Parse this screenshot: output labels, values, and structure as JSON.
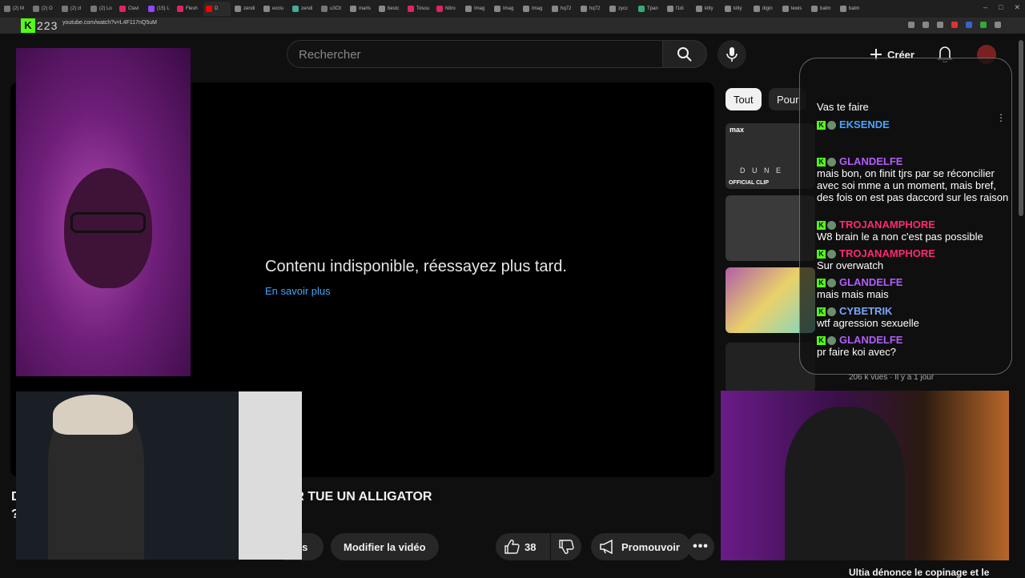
{
  "browser": {
    "tabs": [
      {
        "label": "(2) M",
        "color": "#777"
      },
      {
        "label": "(2) O",
        "color": "#777"
      },
      {
        "label": "(2) cl",
        "color": "#777"
      },
      {
        "label": "(2) Lo",
        "color": "#777"
      },
      {
        "label": "Clavi",
        "color": "#e0245e"
      },
      {
        "label": "(15) L",
        "color": "#9146ff"
      },
      {
        "label": "Flesh",
        "color": "#e0245e"
      },
      {
        "label": "D",
        "color": "#ff0000"
      },
      {
        "label": "zendi",
        "color": "#888"
      },
      {
        "label": "exclu",
        "color": "#888"
      },
      {
        "label": "zendi",
        "color": "#4a9"
      },
      {
        "label": "u3Clt",
        "color": "#777"
      },
      {
        "label": "marts",
        "color": "#888"
      },
      {
        "label": "bestc",
        "color": "#888"
      },
      {
        "label": "Tosou",
        "color": "#e0245e"
      },
      {
        "label": "Nitro",
        "color": "#e0245e"
      },
      {
        "label": "Imag",
        "color": "#888"
      },
      {
        "label": "Imag",
        "color": "#888"
      },
      {
        "label": "Imag",
        "color": "#888"
      },
      {
        "label": "hq72",
        "color": "#888"
      },
      {
        "label": "hq72",
        "color": "#888"
      },
      {
        "label": "zycc",
        "color": "#888"
      },
      {
        "label": "Tpan",
        "color": "#3a7"
      },
      {
        "label": "f1di",
        "color": "#888"
      },
      {
        "label": "kitty",
        "color": "#888"
      },
      {
        "label": "kitty",
        "color": "#888"
      },
      {
        "label": "digin",
        "color": "#888"
      },
      {
        "label": "lewis",
        "color": "#888"
      },
      {
        "label": "batm",
        "color": "#888"
      },
      {
        "label": "batm",
        "color": "#888"
      }
    ],
    "url": "youtube.com/watch?v=L4F117nQ5uM",
    "overlay_counter": "223"
  },
  "header": {
    "search_placeholder": "Rechercher",
    "create_label": "Créer"
  },
  "player": {
    "unavailable_message": "Contenu indisponible, réessayez plus tard.",
    "learn_more_link": "En savoir plus"
  },
  "video": {
    "title": "D TS DIMANCHE 21H????? 😡 💥 CLAVICULAR TUE UN ALLIGATOR",
    "title_line2": "?",
    "stats_label": "ues",
    "edit_label": "Modifier la vidéo",
    "likes": "38",
    "promote_label": "Promouvoir"
  },
  "sidebar": {
    "chips": [
      "Tout",
      "Pour"
    ],
    "thumb1_badge": "max",
    "thumb1_title": "D U N E",
    "thumb1_clip": "OFFICIAL CLIP",
    "item4_meta": "206 k vues · Il y a 1 jour",
    "bottom_item_title": "Ultia dénonce le copinage et le"
  },
  "chat": {
    "messages": [
      {
        "user": "",
        "text": "Vas te faire",
        "color": "#ffffff"
      },
      {
        "user": "EKSENDE",
        "text": "",
        "color": "#4aa3ff"
      },
      {
        "user": "GLANDELFE",
        "text": "mais bon, on finit tjrs par se réconcilier avec soi mme a un moment, mais bref, des fois on est pas daccord sur les raison",
        "color": "#b35cff"
      },
      {
        "user": "TROJANAMPHORE",
        "text": "W8 brain le a non c'est pas possible",
        "color": "#ff2a6d"
      },
      {
        "user": "TROJANAMPHORE",
        "text": "Sur overwatch",
        "color": "#ff2a6d"
      },
      {
        "user": "GLANDELFE",
        "text": "mais mais mais",
        "color": "#b35cff"
      },
      {
        "user": "CYBETRIK",
        "text": "wtf agression sexuelle",
        "color": "#7aa7ff"
      },
      {
        "user": "GLANDELFE",
        "text": "pr faire koi avec?",
        "color": "#b35cff"
      }
    ]
  },
  "colors": {
    "kick_green": "#53fc18",
    "yt_bg": "#0f0f0f",
    "link_blue": "#3ea6ff"
  }
}
